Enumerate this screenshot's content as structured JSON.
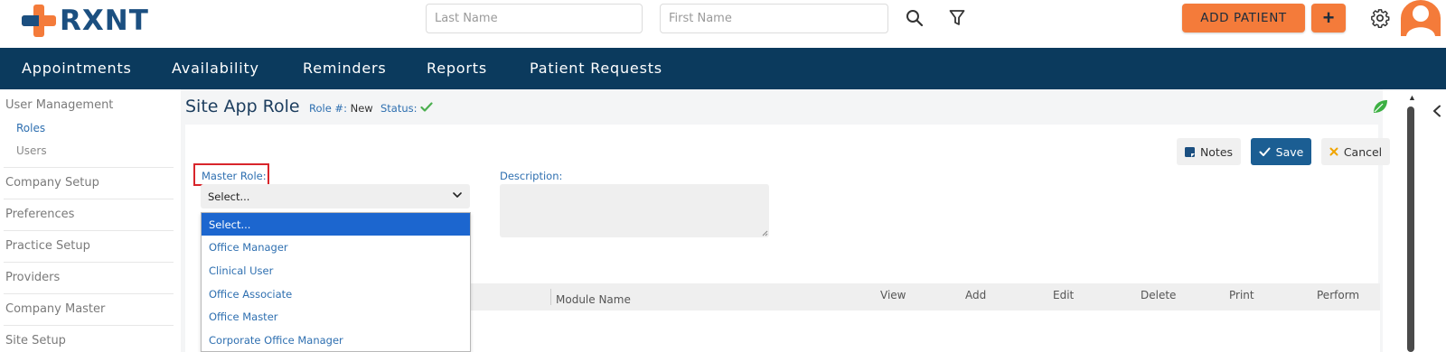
{
  "brand": {
    "name": "RXNT",
    "primary_color": "#1b4f80",
    "accent_color": "#f47b3a"
  },
  "header": {
    "last_name_placeholder": "Last Name",
    "first_name_placeholder": "First Name",
    "search_icon": "search-icon",
    "filter_icon": "filter-icon",
    "add_patient_label": "ADD PATIENT",
    "add_plus_label": "+",
    "settings_icon": "gear-icon",
    "avatar_icon": "user-avatar"
  },
  "nav": {
    "background": "#0b3a5d",
    "items": [
      "Appointments",
      "Availability",
      "Reminders",
      "Reports",
      "Patient Requests"
    ]
  },
  "sidebar": {
    "user_management": "User Management",
    "roles": "Roles",
    "users": "Users",
    "company_setup": "Company Setup",
    "preferences": "Preferences",
    "practice_setup": "Practice Setup",
    "providers": "Providers",
    "company_master": "Company Master",
    "site_setup": "Site Setup"
  },
  "page": {
    "title": "Site App Role",
    "role_label": "Role #:",
    "role_value": "New",
    "status_label": "Status:",
    "status_icon": "check-icon"
  },
  "toolbar": {
    "notes": "Notes",
    "save": "Save",
    "cancel": "Cancel"
  },
  "form": {
    "master_role_label": "Master Role:",
    "master_role_value": "Select...",
    "description_label": "Description:",
    "dropdown_options": [
      "Select...",
      "Office Manager",
      "Clinical User",
      "Office Associate",
      "Office Master",
      "Corporate Office Manager"
    ],
    "selected_index": 0
  },
  "table": {
    "columns": [
      "Module Name",
      "View",
      "Add",
      "Edit",
      "Delete",
      "Print",
      "Perform"
    ]
  }
}
